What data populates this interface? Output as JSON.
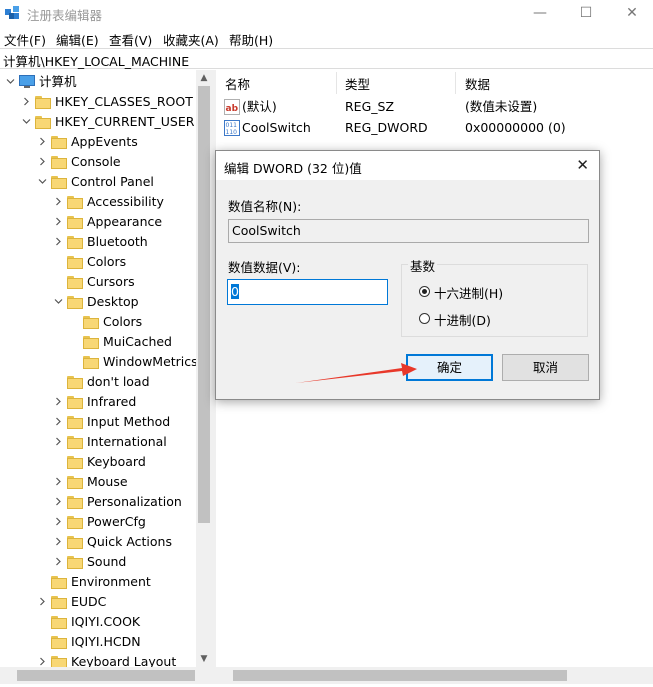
{
  "window": {
    "title": "注册表编辑器",
    "minimize": "—",
    "maximize": "☐",
    "close": "✕"
  },
  "menu": [
    "文件(F)",
    "编辑(E)",
    "查看(V)",
    "收藏夹(A)",
    "帮助(H)"
  ],
  "address": "计算机\\HKEY_LOCAL_MACHINE",
  "tree": [
    {
      "label": "计算机",
      "expander": "open",
      "icon": "computer-icon"
    },
    {
      "label": "HKEY_CLASSES_ROOT",
      "expander": "closed"
    },
    {
      "label": "HKEY_CURRENT_USER",
      "expander": "open"
    },
    {
      "label": "AppEvents",
      "expander": "closed"
    },
    {
      "label": "Console",
      "expander": "closed"
    },
    {
      "label": "Control Panel",
      "expander": "open"
    },
    {
      "label": "Accessibility",
      "expander": "closed"
    },
    {
      "label": "Appearance",
      "expander": "closed"
    },
    {
      "label": "Bluetooth",
      "expander": "closed"
    },
    {
      "label": "Colors",
      "expander": "none"
    },
    {
      "label": "Cursors",
      "expander": "none"
    },
    {
      "label": "Desktop",
      "expander": "open"
    },
    {
      "label": "Colors",
      "expander": "none"
    },
    {
      "label": "MuiCached",
      "expander": "none"
    },
    {
      "label": "WindowMetrics",
      "expander": "none"
    },
    {
      "label": "don't load",
      "expander": "none"
    },
    {
      "label": "Infrared",
      "expander": "closed"
    },
    {
      "label": "Input Method",
      "expander": "closed"
    },
    {
      "label": "International",
      "expander": "closed"
    },
    {
      "label": "Keyboard",
      "expander": "none"
    },
    {
      "label": "Mouse",
      "expander": "closed"
    },
    {
      "label": "Personalization",
      "expander": "closed"
    },
    {
      "label": "PowerCfg",
      "expander": "closed"
    },
    {
      "label": "Quick Actions",
      "expander": "closed"
    },
    {
      "label": "Sound",
      "expander": "closed"
    },
    {
      "label": "Environment",
      "expander": "none"
    },
    {
      "label": "EUDC",
      "expander": "closed"
    },
    {
      "label": "IQIYI.COOK",
      "expander": "none"
    },
    {
      "label": "IQIYI.HCDN",
      "expander": "none"
    },
    {
      "label": "Keyboard Layout",
      "expander": "closed"
    }
  ],
  "list": {
    "headers": [
      "名称",
      "类型",
      "数据"
    ],
    "rows": [
      {
        "icon": "string-value-icon",
        "name": "(默认)",
        "type": "REG_SZ",
        "data": "(数值未设置)"
      },
      {
        "icon": "binary-value-icon",
        "name": "CoolSwitch",
        "type": "REG_DWORD",
        "data": "0x00000000 (0)"
      }
    ]
  },
  "dialog": {
    "title": "编辑 DWORD (32 位)值",
    "close": "✕",
    "name_label": "数值名称(N):",
    "name_value": "CoolSwitch",
    "data_label": "数值数据(V):",
    "data_value": "0",
    "base_label": "基数",
    "radio_hex": "十六进制(H)",
    "radio_dec": "十进制(D)",
    "radio_selected": "hex",
    "ok": "确定",
    "cancel": "取消"
  },
  "colors": {
    "accent": "#0078d7",
    "annotation_arrow": "#e8382a",
    "folder": "#f8d775"
  }
}
